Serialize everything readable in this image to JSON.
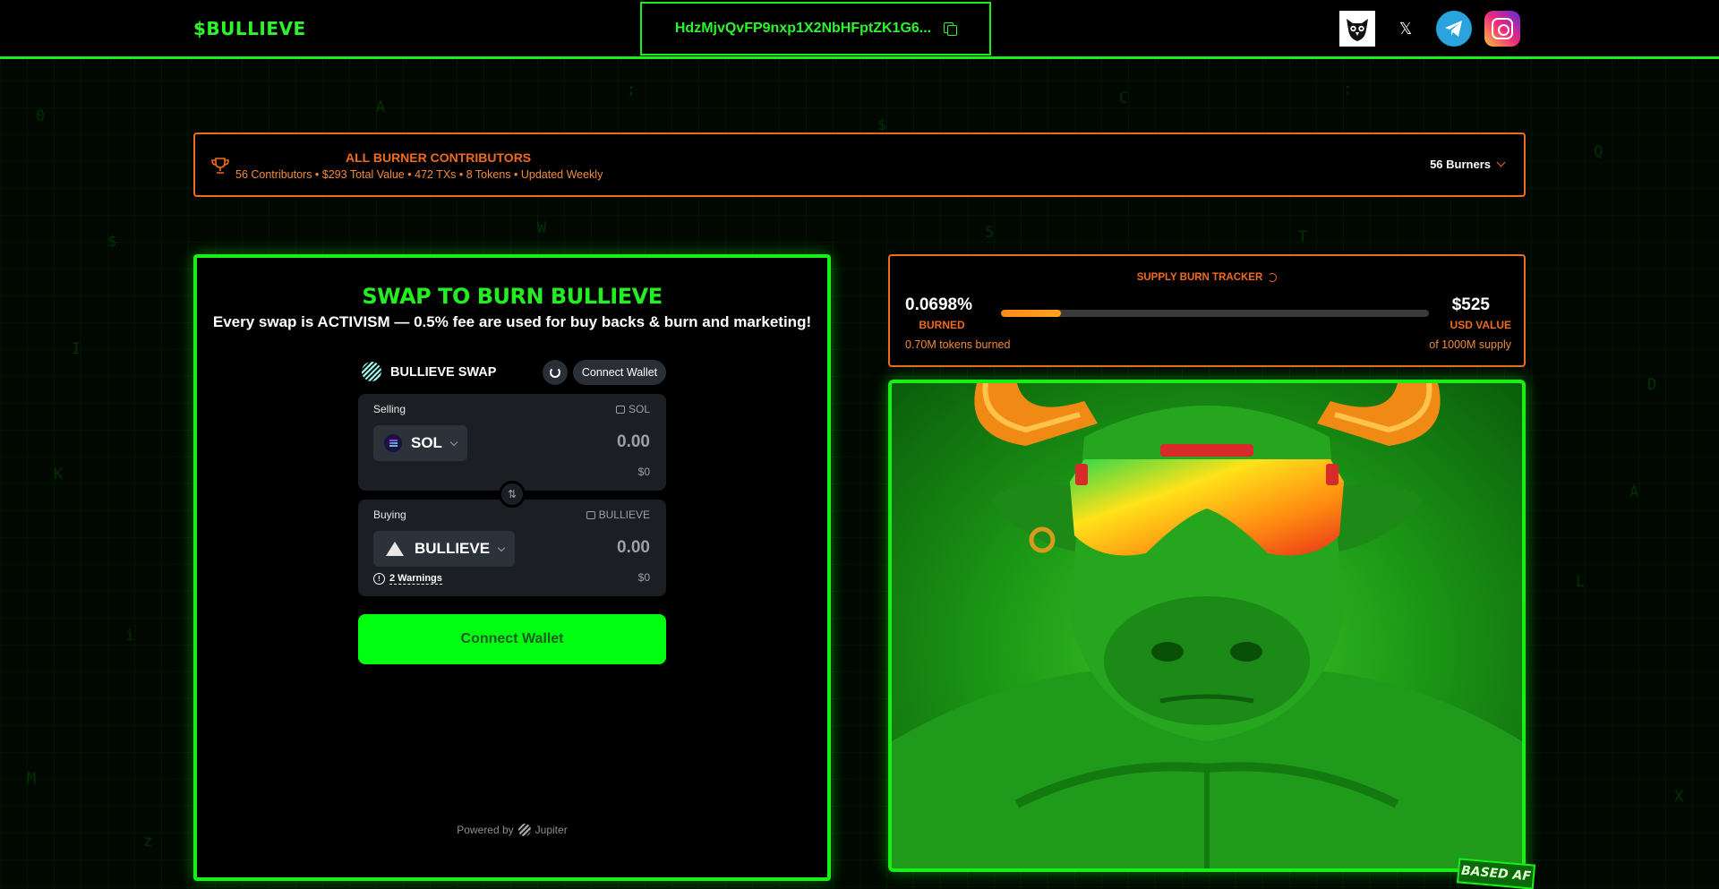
{
  "header": {
    "logo": "$BULLIEVE",
    "contract_address": "HdzMjvQvFP9nxp1X2NbHFptZK1G6...",
    "socials": [
      "owl-icon",
      "x-icon",
      "telegram-icon",
      "instagram-icon"
    ],
    "x_glyph": "𝕏"
  },
  "contributors": {
    "title": "ALL BURNER CONTRIBUTORS",
    "summary": "56 Contributors • $293 Total Value • 472 TXs • 8 Tokens • Updated Weekly",
    "burners_button": "56 Burners"
  },
  "swap": {
    "title": "SWAP TO BURN BULLIEVE",
    "subtitle": "Every swap is ACTIVISM — 0.5% fee are used for buy backs & burn and marketing!",
    "widget_name": "BULLIEVE SWAP",
    "connect_wallet_small": "Connect Wallet",
    "selling": {
      "label": "Selling",
      "balance_token": "SOL",
      "token": "SOL",
      "amount": "0.00",
      "usd": "$0"
    },
    "buying": {
      "label": "Buying",
      "balance_token": "BULLIEVE",
      "token": "BULLIEVE",
      "amount": "0.00",
      "usd": "$0",
      "warnings": "2 Warnings",
      "warning_glyph": "!"
    },
    "flip_glyph": "⇅",
    "connect_wallet_button": "Connect Wallet",
    "powered_by": "Powered by",
    "powered_brand": "Jupiter"
  },
  "tracker": {
    "title": "SUPPLY BURN TRACKER",
    "percent": "0.0698%",
    "percent_label": "BURNED",
    "progress_fill": 0.14,
    "usd_value": "$525",
    "usd_label": "USD VALUE",
    "tokens_burned": "0.70M tokens burned",
    "supply": "of 1000M supply"
  },
  "badge": "BASED AF",
  "colors": {
    "accent_green": "#16f016",
    "accent_orange": "#f06a1c"
  }
}
